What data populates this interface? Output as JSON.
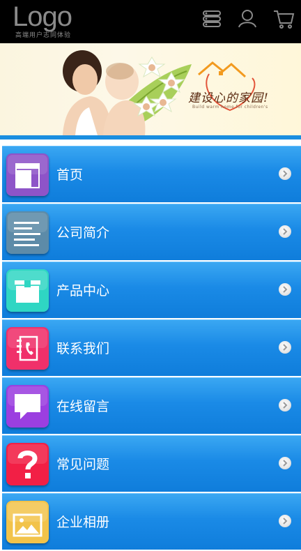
{
  "header": {
    "logo": "Logo",
    "logo_sub": "高端用户志同体验",
    "icons": [
      "list-icon",
      "user-icon",
      "cart-icon"
    ]
  },
  "banner": {
    "slogan": "建设心的家园!",
    "slogan_sub": "Build warm home for children's"
  },
  "colors": {
    "menu_top": "#3aa7f2",
    "menu_bottom": "#0f7ddb",
    "header_bg": "#000000",
    "banner_stripe": "#1a8ee0"
  },
  "menu": {
    "items": [
      {
        "label": "首页",
        "icon": "home-layout-icon",
        "color": "#8e54c8"
      },
      {
        "label": "公司简介",
        "icon": "text-lines-icon",
        "color": "#5d8ba8"
      },
      {
        "label": "产品中心",
        "icon": "box-icon",
        "color": "#2fd6c3"
      },
      {
        "label": "联系我们",
        "icon": "phone-book-icon",
        "color": "#f0306a"
      },
      {
        "label": "在线留言",
        "icon": "chat-bubble-icon",
        "color": "#9b3fe0"
      },
      {
        "label": "常见问题",
        "icon": "question-icon",
        "color": "#f21f45"
      },
      {
        "label": "企业相册",
        "icon": "photo-icon",
        "color": "#f2c34a"
      }
    ]
  }
}
